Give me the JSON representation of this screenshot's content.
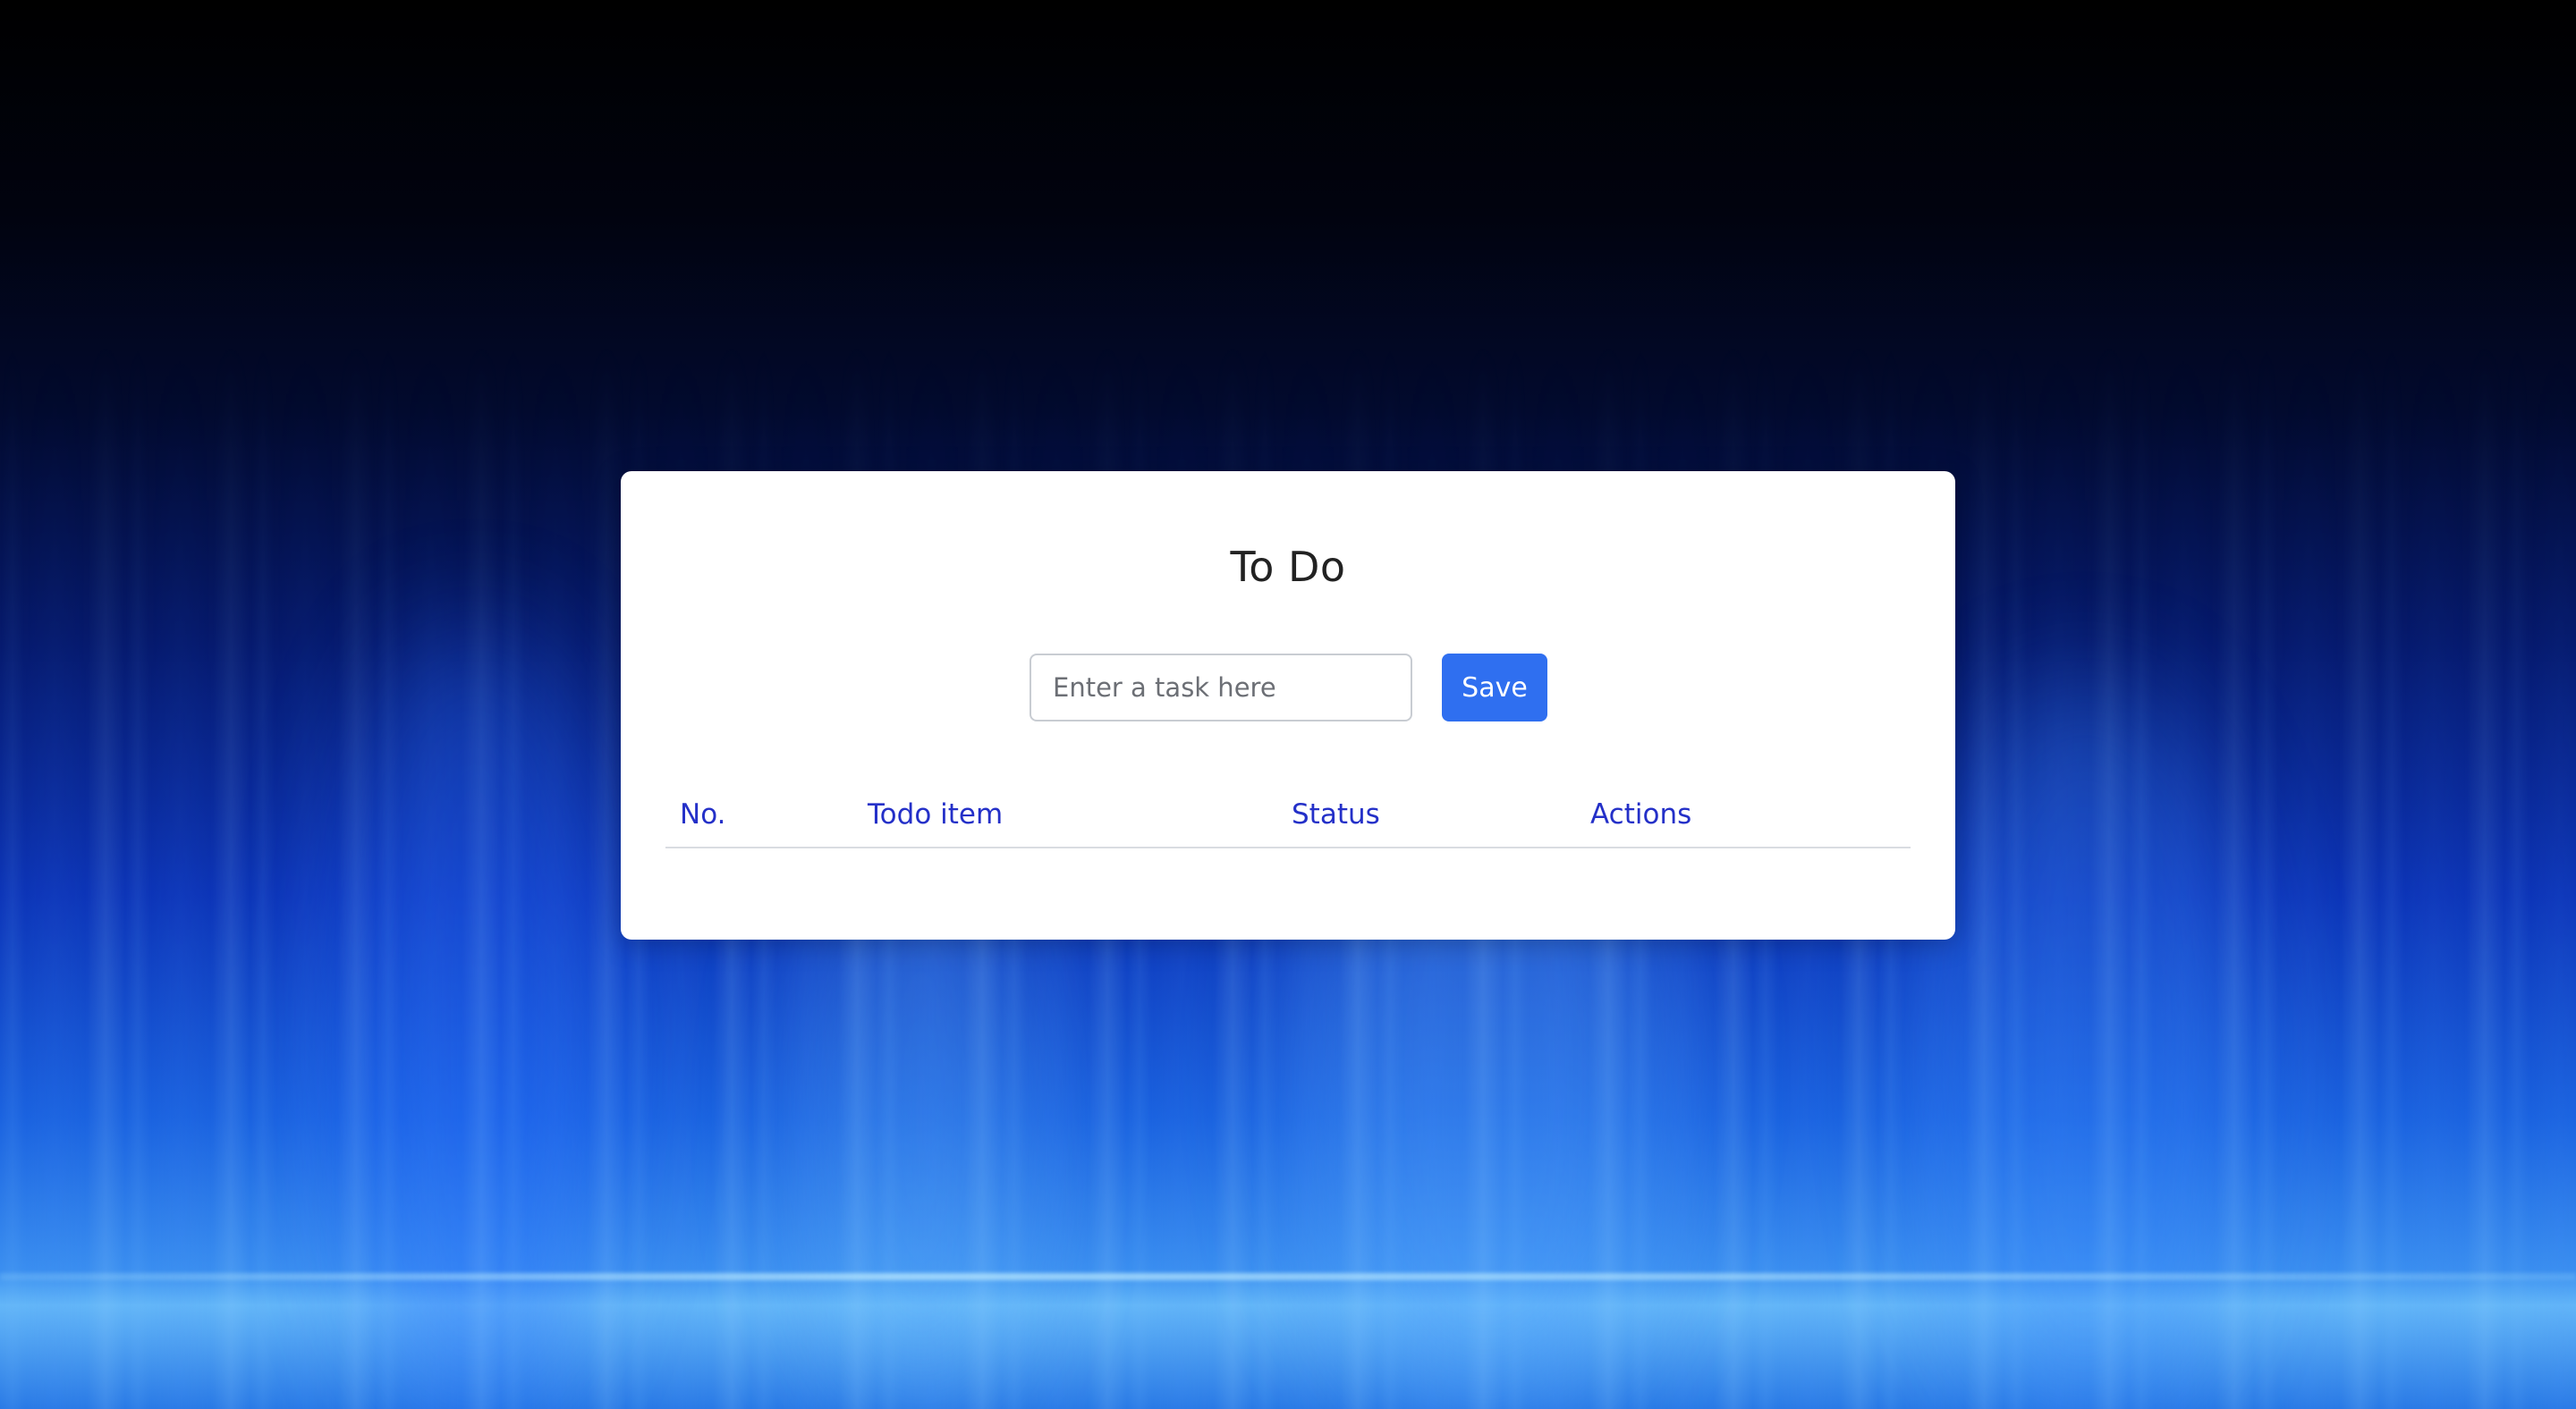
{
  "app": {
    "title": "To Do"
  },
  "form": {
    "task_placeholder": "Enter a task here",
    "task_value": "",
    "save_label": "Save"
  },
  "table": {
    "columns": [
      "No.",
      "Todo item",
      "Status",
      "Actions"
    ],
    "rows": []
  },
  "colors": {
    "accent": "#2f6ff0",
    "header_text": "#2430c8",
    "card_background": "#ffffff"
  }
}
